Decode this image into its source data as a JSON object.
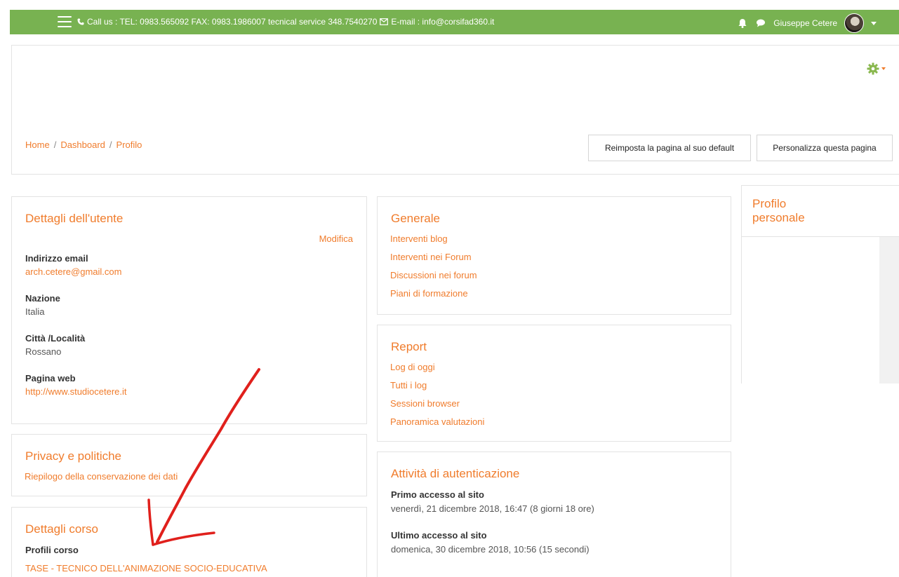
{
  "navbar": {
    "contact_text": "Call us : TEL: 0983.565092 FAX: 0983.1986007 tecnical service 348.7540270",
    "email_text": "E-mail : info@corsifad360.it",
    "username": "Giuseppe Cetere",
    "bg_color": "#78b251"
  },
  "breadcrumb": {
    "items": [
      "Home",
      "Dashboard",
      "Profilo"
    ],
    "separator": "/"
  },
  "header": {
    "reset_button": "Reimposta la pagina al suo default",
    "customize_button": "Personalizza questa pagina"
  },
  "user_details": {
    "title": "Dettagli dell'utente",
    "edit_link": "Modifica",
    "email_label": "Indirizzo email",
    "email_value": "arch.cetere@gmail.com",
    "country_label": "Nazione",
    "country_value": "Italia",
    "city_label": "Città /Località",
    "city_value": "Rossano",
    "web_label": "Pagina web",
    "web_value": "http://www.studiocetere.it"
  },
  "privacy": {
    "title": "Privacy e politiche",
    "link": "Riepilogo della conservazione dei dati"
  },
  "course_details": {
    "title": "Dettagli corso",
    "profiles_label": "Profili corso",
    "course_link": "TASE - TECNICO DELL'ANIMAZIONE SOCIO-EDUCATIVA"
  },
  "general": {
    "title": "Generale",
    "links": [
      "Interventi blog",
      "Interventi nei Forum",
      "Discussioni nei forum",
      "Piani di formazione"
    ]
  },
  "report": {
    "title": "Report",
    "links": [
      "Log di oggi",
      "Tutti i log",
      "Sessioni browser",
      "Panoramica valutazioni"
    ]
  },
  "auth": {
    "title": "Attività di autenticazione",
    "first_label": "Primo accesso al sito",
    "first_value": "venerdì, 21 dicembre 2018, 16:47  (8 giorni 18 ore)",
    "last_label": "Ultimo accesso al sito",
    "last_value": "domenica, 30 dicembre 2018, 10:56  (15 secondi)"
  },
  "side": {
    "title": "Profilo personale"
  },
  "colors": {
    "accent": "#f07c2c",
    "annotation": "#e0201c"
  }
}
